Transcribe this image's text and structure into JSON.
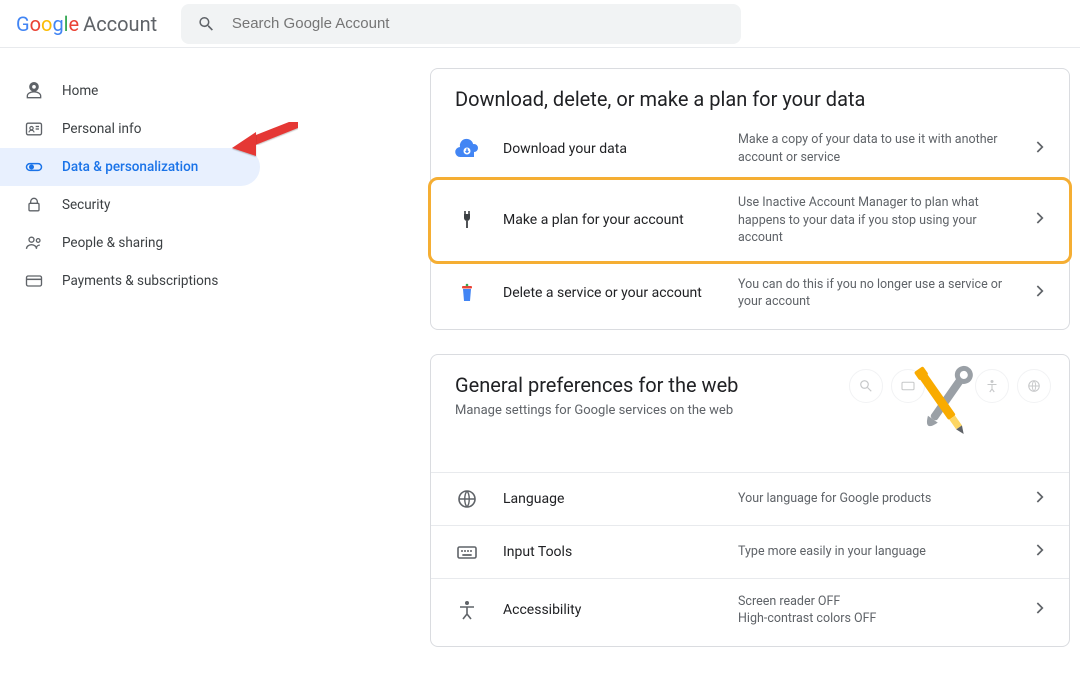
{
  "header": {
    "logo_account": "Account",
    "search_placeholder": "Search Google Account"
  },
  "sidebar": {
    "items": [
      {
        "label": "Home"
      },
      {
        "label": "Personal info"
      },
      {
        "label": "Data & personalization"
      },
      {
        "label": "Security"
      },
      {
        "label": "People & sharing"
      },
      {
        "label": "Payments & subscriptions"
      }
    ]
  },
  "card1": {
    "title": "Download, delete, or make a plan for your data",
    "rows": [
      {
        "label": "Download your data",
        "desc": "Make a copy of your data to use it with another account or service"
      },
      {
        "label": "Make a plan for your account",
        "desc": "Use Inactive Account Manager to plan what happens to your data if you stop using your account"
      },
      {
        "label": "Delete a service or your account",
        "desc": "You can do this if you no longer use a service or your account"
      }
    ]
  },
  "card2": {
    "title": "General preferences for the web",
    "subtitle": "Manage settings for Google services on the web",
    "rows": [
      {
        "label": "Language",
        "desc": "Your language for Google products"
      },
      {
        "label": "Input Tools",
        "desc": "Type more easily in your language"
      },
      {
        "label": "Accessibility",
        "desc": "Screen reader OFF\nHigh-contrast colors OFF"
      }
    ]
  }
}
